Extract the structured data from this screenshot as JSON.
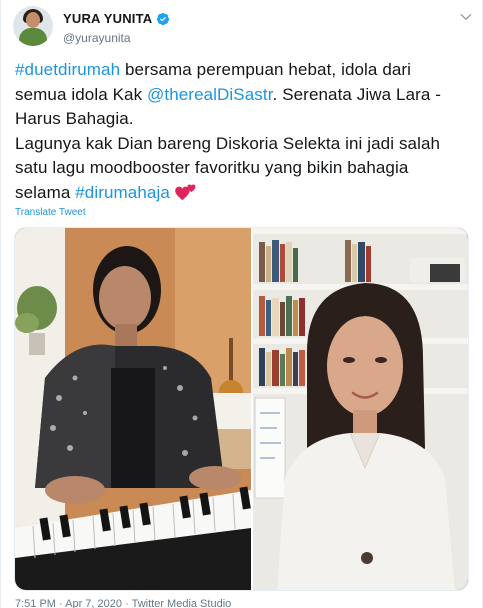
{
  "user": {
    "display_name": "YURA YUNITA",
    "handle": "@yurayunita",
    "verified": true,
    "avatar_icon": "avatar-photo"
  },
  "tweet": {
    "line1_hashtag": "#duetdirumah",
    "line1_text": " bersama perempuan hebat, idola dari semua idola Kak ",
    "mention": "@therealDiSastr",
    "line2_text": ". Serenata Jiwa Lara - Harus Bahagia.",
    "para2_text": "Lagunya kak Dian bareng Diskoria Selekta ini jadi salah satu lagu moodbooster favoritku yang bikin bahagia selama ",
    "para2_hashtag": "#dirumahaja",
    "emoji": "two-hearts-icon"
  },
  "translate_label": "Translate Tweet",
  "footer": {
    "timestamp": "7:51 PM · Apr 7, 2020",
    "separator": " · ",
    "source": "Twitter Media Studio"
  },
  "colors": {
    "link": "#1b95e0",
    "text": "#14171a",
    "secondary": "#657786",
    "verified": "#1da1f2"
  }
}
